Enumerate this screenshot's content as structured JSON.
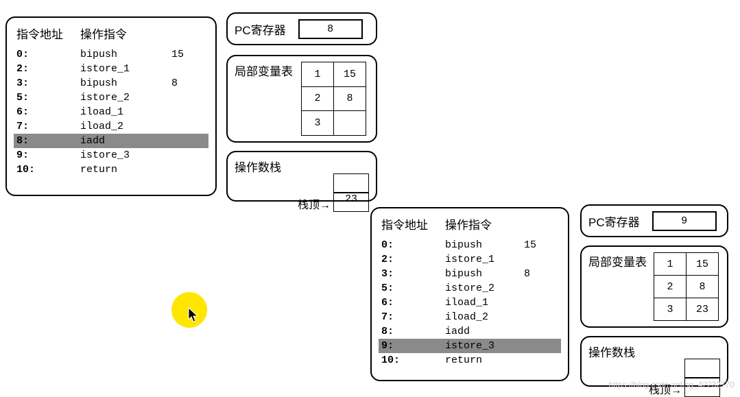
{
  "frame1": {
    "instructions": {
      "header_addr": "指令地址",
      "header_op": "操作指令",
      "rows": [
        {
          "addr": "0:",
          "op": "bipush",
          "arg": "15",
          "hl": false
        },
        {
          "addr": "2:",
          "op": "istore_1",
          "arg": "",
          "hl": false
        },
        {
          "addr": "3:",
          "op": "bipush",
          "arg": "8",
          "hl": false
        },
        {
          "addr": "5:",
          "op": "istore_2",
          "arg": "",
          "hl": false
        },
        {
          "addr": "6:",
          "op": "iload_1",
          "arg": "",
          "hl": false
        },
        {
          "addr": "7:",
          "op": "iload_2",
          "arg": "",
          "hl": false
        },
        {
          "addr": "8:",
          "op": "iadd",
          "arg": "",
          "hl": true
        },
        {
          "addr": "9:",
          "op": "istore_3",
          "arg": "",
          "hl": false
        },
        {
          "addr": "10:",
          "op": "return",
          "arg": "",
          "hl": false
        }
      ]
    },
    "pc": {
      "label": "PC寄存器",
      "value": "8"
    },
    "local_vars": {
      "label": "局部变量表",
      "rows": [
        {
          "idx": "1",
          "val": "15"
        },
        {
          "idx": "2",
          "val": "8"
        },
        {
          "idx": "3",
          "val": ""
        }
      ]
    },
    "operand_stack": {
      "label": "操作数栈",
      "top_label": "栈顶",
      "cells": [
        "",
        "23"
      ]
    }
  },
  "frame2": {
    "instructions": {
      "header_addr": "指令地址",
      "header_op": "操作指令",
      "rows": [
        {
          "addr": "0:",
          "op": "bipush",
          "arg": "15",
          "hl": false
        },
        {
          "addr": "2:",
          "op": "istore_1",
          "arg": "",
          "hl": false
        },
        {
          "addr": "3:",
          "op": "bipush",
          "arg": "8",
          "hl": false
        },
        {
          "addr": "5:",
          "op": "istore_2",
          "arg": "",
          "hl": false
        },
        {
          "addr": "6:",
          "op": "iload_1",
          "arg": "",
          "hl": false
        },
        {
          "addr": "7:",
          "op": "iload_2",
          "arg": "",
          "hl": false
        },
        {
          "addr": "8:",
          "op": "iadd",
          "arg": "",
          "hl": false
        },
        {
          "addr": "9:",
          "op": "istore_3",
          "arg": "",
          "hl": true
        },
        {
          "addr": "10:",
          "op": "return",
          "arg": "",
          "hl": false
        }
      ]
    },
    "pc": {
      "label": "PC寄存器",
      "value": "9"
    },
    "local_vars": {
      "label": "局部变量表",
      "rows": [
        {
          "idx": "1",
          "val": "15"
        },
        {
          "idx": "2",
          "val": "8"
        },
        {
          "idx": "3",
          "val": "23"
        }
      ]
    },
    "operand_stack": {
      "label": "操作数栈",
      "top_label": "栈顶",
      "cells": [
        "",
        ""
      ]
    }
  },
  "watermark": "https://blog.csdn.net/sg_42232770"
}
